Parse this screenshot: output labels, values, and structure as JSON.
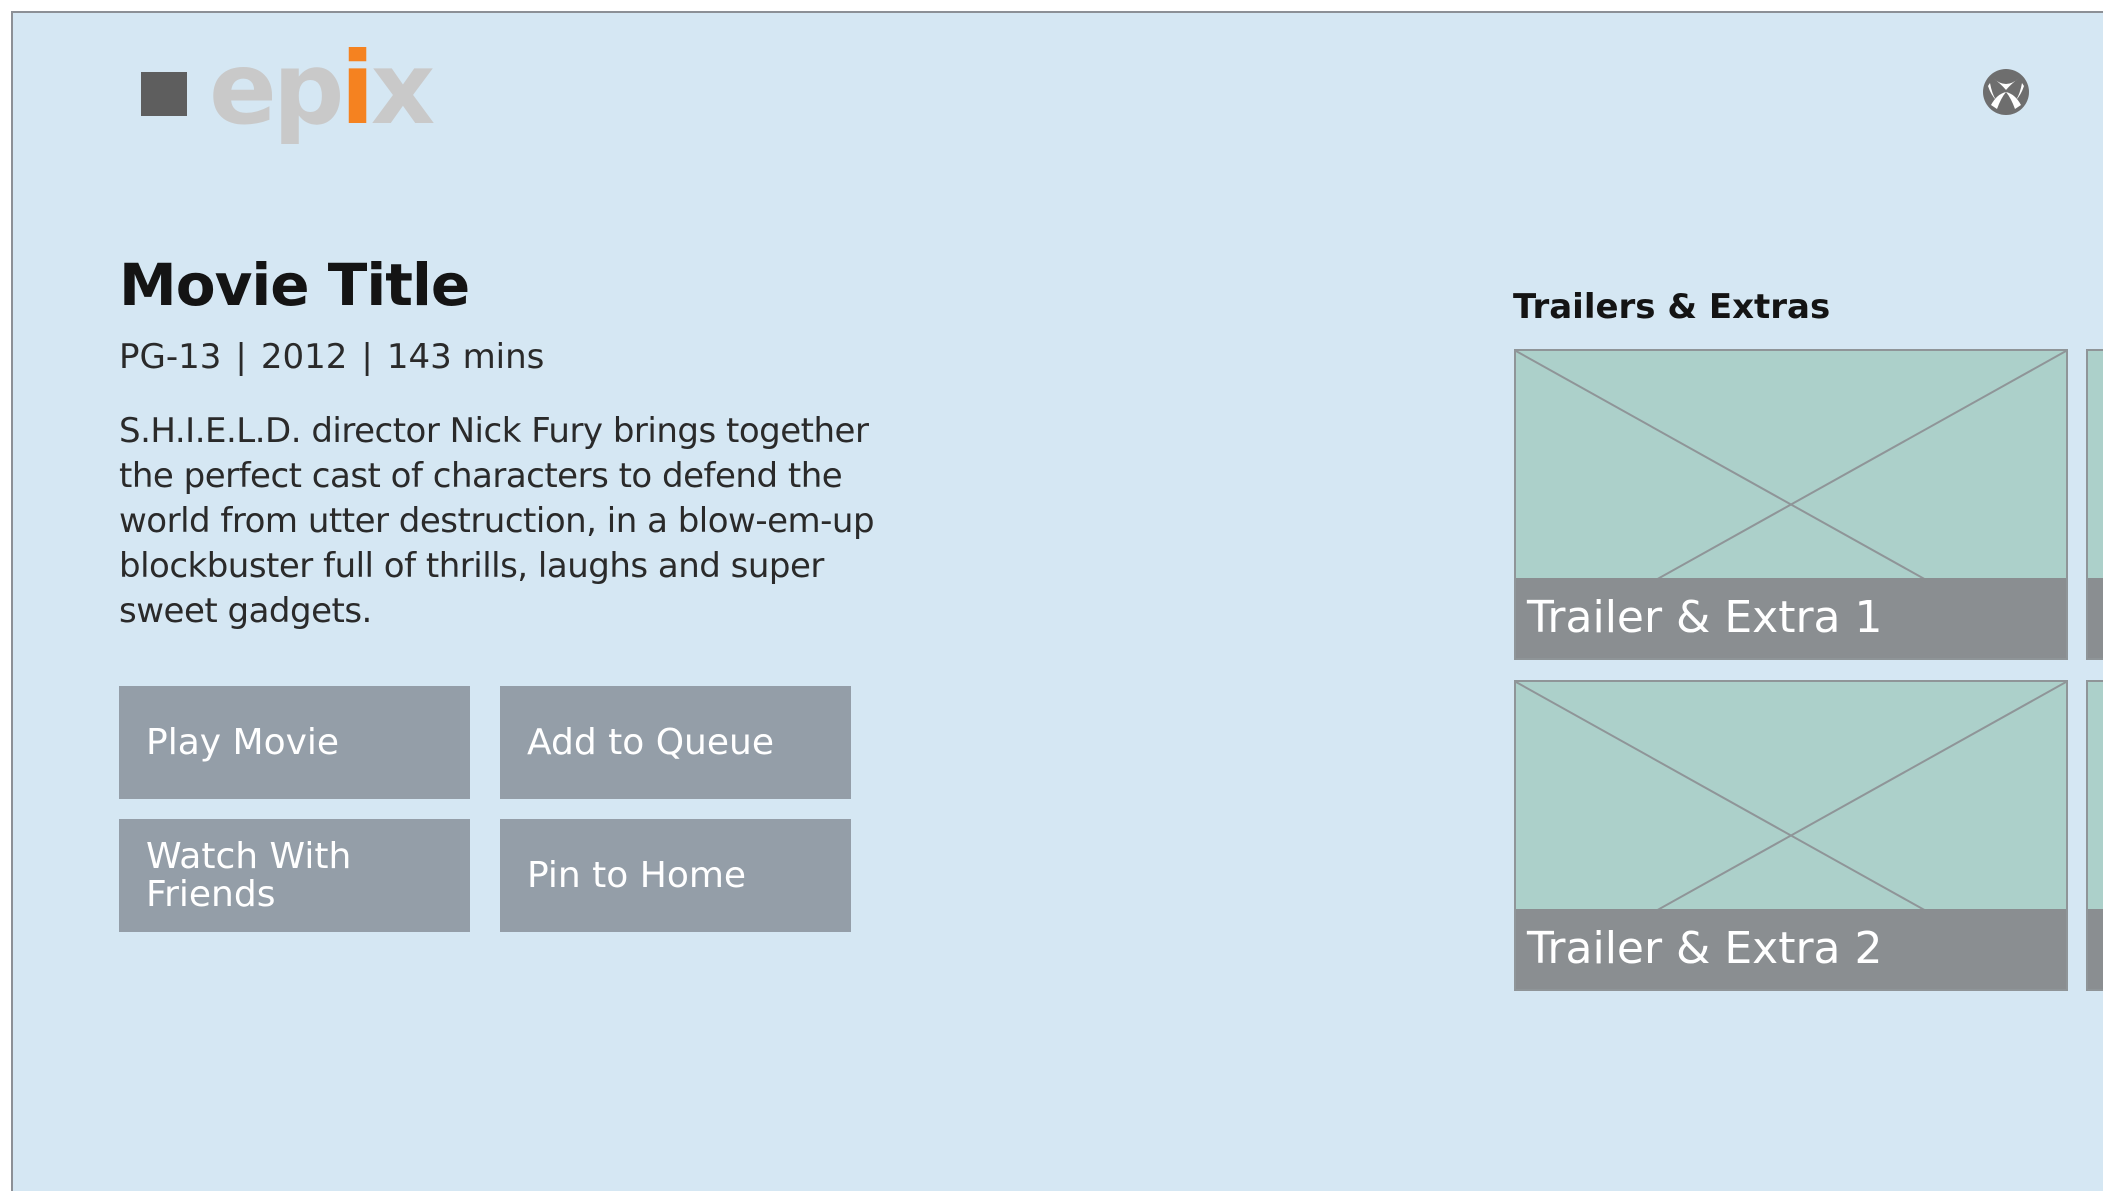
{
  "header": {
    "logo": {
      "part1": "ep",
      "part2": "i",
      "part3": "x",
      "text_color": "#c9c9c9",
      "accent_color": "#f58220"
    },
    "xbox_icon": "xbox-icon"
  },
  "movie": {
    "title": "Movie Title",
    "rating": "PG-13",
    "year": "2012",
    "duration": "143 mins",
    "separator": "|",
    "synopsis": "S.H.I.E.L.D. director Nick Fury brings together the perfect cast of characters to defend the world from utter destruction, in a blow-em-up blockbuster full of thrills, laughs and super sweet gadgets."
  },
  "actions": {
    "play_movie": "Play Movie",
    "add_to_queue": "Add to Queue",
    "watch_with_friends": "Watch With Friends",
    "pin_to_home": "Pin to Home"
  },
  "trailers": {
    "heading": "Trailers & Extras",
    "items": [
      {
        "label": "Trailer & Extra 1"
      },
      {
        "label": "Trailer & Extra 2"
      }
    ]
  },
  "colors": {
    "background": "#d5e7f3",
    "button": "#949ea8",
    "tile_fill": "#acd0ca",
    "tile_caption": "#8a8e91"
  }
}
